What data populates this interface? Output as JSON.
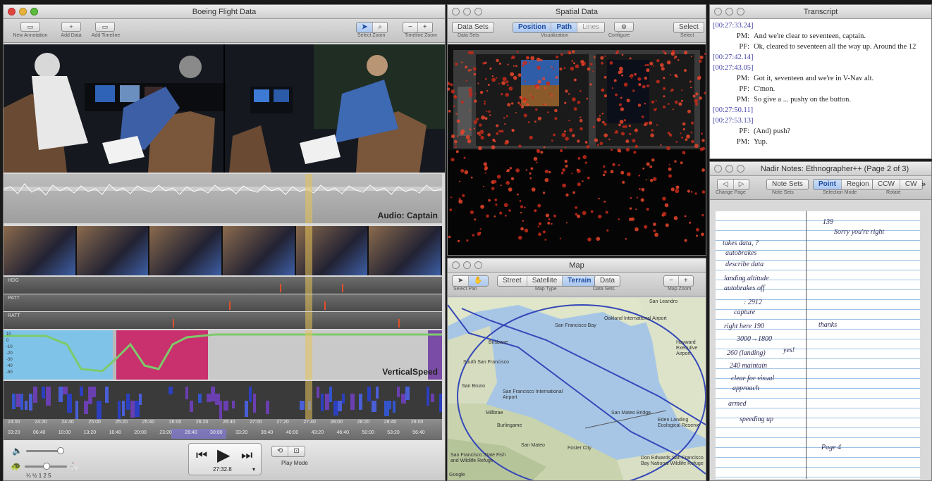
{
  "main": {
    "title": "Boeing Flight Data",
    "toolbar": {
      "new_annotation": "New Annotation",
      "add_data": "Add Data",
      "add_timeline": "Add Timeline",
      "select": "Select",
      "zoom": "Zoom",
      "timeline_zoom": "Timeline Zoom"
    },
    "tracks": {
      "audio_label": "Audio: Captain",
      "hdg": "HDG",
      "patt": "PATT",
      "ratt": "RATT",
      "vs_label": "VerticalSpeed",
      "vs_ticks": [
        "10",
        "0",
        "-10",
        "-20",
        "-30",
        "-40",
        "-50"
      ]
    },
    "ruler_top": [
      "24:00",
      "24:20",
      "24:40",
      "25:00",
      "25:20",
      "25:40",
      "26:00",
      "26:20",
      "26:40",
      "27:00",
      "27:20",
      "27:40",
      "28:00",
      "28:20",
      "28:40",
      "29:00"
    ],
    "ruler_bottom": [
      "03:20",
      "06:40",
      "10:00",
      "13:20",
      "16:40",
      "20:00",
      "23:20",
      "26:40",
      "30:00",
      "33:20",
      "36:40",
      "40:00",
      "43:20",
      "46:40",
      "50:00",
      "53:20",
      "56:40"
    ],
    "speeds": "¼ ½ 1 2 5",
    "time": "27:32.8",
    "play_mode": "Play Mode"
  },
  "spatial": {
    "title": "Spatial Data",
    "data_sets": "Data Sets",
    "data_sets_lbl": "Data Sets",
    "vis": [
      "Position",
      "Path",
      "Lines"
    ],
    "vis_lbl": "Visualization",
    "configure_lbl": "Configure",
    "select": "Select",
    "select_lbl": "Select"
  },
  "map": {
    "title": "Map",
    "types": [
      "Street",
      "Satellite",
      "Terrain"
    ],
    "select_lbl": "Select",
    "pan_lbl": "Pan",
    "type_lbl": "Map Type",
    "data": "Data",
    "data_lbl": "Data Sets",
    "zoom_lbl": "Map Zoom",
    "places": [
      "Oakland International Airport",
      "San Francisco Bay",
      "San Leandro",
      "Hayward Executive Airport",
      "South San Francisco",
      "San Bruno",
      "San Francisco International Airport",
      "Millbrae",
      "Burlingame",
      "San Mateo",
      "Foster City",
      "San Mateo Bridge",
      "Eden Landing Ecological Reserve",
      "Don Edwards San Francisco Bay National Wildlife Refuge",
      "Brisbane",
      "San Francisco State Fish and Wildlife Refuge",
      "Google"
    ]
  },
  "transcript": {
    "title": "Transcript",
    "lines": [
      {
        "ts": "[00:27:33.24]"
      },
      {
        "spk": "PM:",
        "text": "And we're clear to seventeen, captain."
      },
      {
        "spk": "PF:",
        "text": "Ok, cleared to seventeen all the way up. Around the 12"
      },
      {
        "ts": "[00:27:42.14]"
      },
      {
        "ts": "[00:27:43.05]"
      },
      {
        "spk": "PM:",
        "text": "Got it, seventeen and we're in V-Nav alt."
      },
      {
        "spk": "PF:",
        "text": "C'mon."
      },
      {
        "spk": "PM:",
        "text": "So give a ... pushy on the button."
      },
      {
        "ts": "[00:27:50.11]"
      },
      {
        "ts": "[00:27:53.13]"
      },
      {
        "spk": "PF:",
        "text": "(And) push?"
      },
      {
        "spk": "PM:",
        "text": "Yup."
      }
    ]
  },
  "notes": {
    "title": "Nadir Notes: Ethnographer++ (Page 2 of 3)",
    "change_page_lbl": "Change Page",
    "note_sets": "Note Sets",
    "note_sets_lbl": "Note Sets",
    "modes": [
      "Point",
      "Region"
    ],
    "mode_lbl": "Selection Mode",
    "rotate": [
      "CCW",
      "CW"
    ],
    "rotate_lbl": "Rotate",
    "handwriting": [
      "139",
      "Sorry you're right",
      "takes data, ?",
      "autobrakes",
      "describe data",
      "landing altitude",
      "autobrakes off",
      ": 2912",
      "capture",
      "right here 190",
      "3000→1800",
      "260 (landing)",
      "240 maintain",
      "clear for visual",
      "approach",
      "armed",
      "speeding up",
      "yes!",
      "thanks",
      "Page 4"
    ]
  }
}
